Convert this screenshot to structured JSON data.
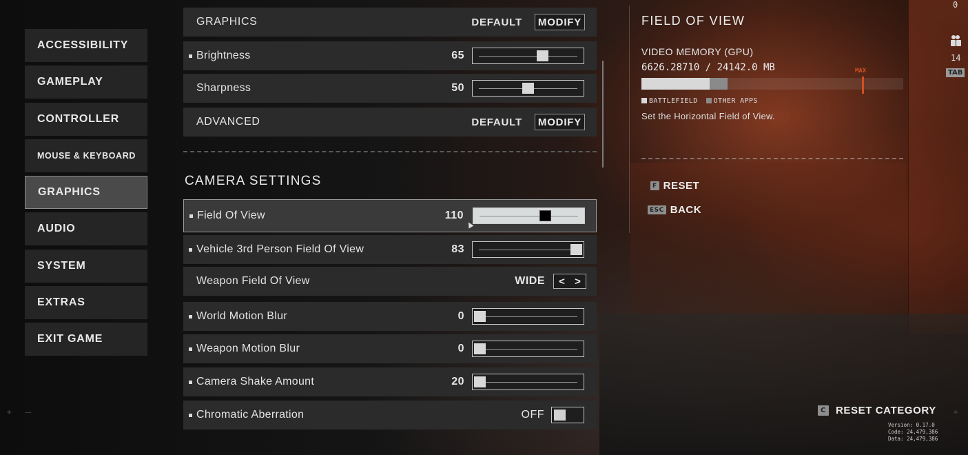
{
  "nav": {
    "items": [
      {
        "label": "ACCESSIBILITY",
        "active": false
      },
      {
        "label": "GAMEPLAY",
        "active": false
      },
      {
        "label": "CONTROLLER",
        "active": false
      },
      {
        "label": "MOUSE & KEYBOARD",
        "active": false
      },
      {
        "label": "GRAPHICS",
        "active": true
      },
      {
        "label": "AUDIO",
        "active": false
      },
      {
        "label": "SYSTEM",
        "active": false
      },
      {
        "label": "EXTRAS",
        "active": false
      },
      {
        "label": "EXIT GAME",
        "active": false
      }
    ]
  },
  "graphics_section": {
    "graphics_row": {
      "label": "GRAPHICS",
      "default_label": "DEFAULT",
      "modify_label": "MODIFY"
    },
    "brightness": {
      "label": "Brightness",
      "value": "65",
      "fraction": 0.65
    },
    "sharpness": {
      "label": "Sharpness",
      "value": "50",
      "fraction": 0.5
    },
    "advanced_row": {
      "label": "ADVANCED",
      "default_label": "DEFAULT",
      "modify_label": "MODIFY"
    }
  },
  "camera_section": {
    "title": "CAMERA SETTINGS",
    "fov": {
      "label": "Field Of View",
      "value": "110",
      "fraction": 0.67
    },
    "vehicle_fov": {
      "label": "Vehicle 3rd Person Field Of View",
      "value": "83",
      "fraction": 1.0
    },
    "weapon_fov": {
      "label": "Weapon Field Of View",
      "value": "WIDE",
      "prev": "<",
      "next": ">"
    },
    "world_blur": {
      "label": "World Motion Blur",
      "value": "0",
      "fraction": 0.0
    },
    "weapon_blur": {
      "label": "Weapon Motion Blur",
      "value": "0",
      "fraction": 0.0
    },
    "camera_shake": {
      "label": "Camera Shake Amount",
      "value": "20",
      "fraction": 0.0
    },
    "chromatic": {
      "label": "Chromatic Aberration",
      "value": "OFF",
      "on": false
    }
  },
  "info_panel": {
    "title": "FIELD OF VIEW",
    "vm_label": "VIDEO MEMORY (GPU)",
    "vm_value": "6626.28710 / 24142.0 MB",
    "battlefield_fraction": 0.26,
    "other_apps_fraction": 0.07,
    "max_fraction": 0.85,
    "max_label": "MAX",
    "legend_battlefield": "BATTLEFIELD",
    "legend_other": "OTHER APPS",
    "description": "Set the Horizontal Field of View.",
    "reset_key": "F",
    "reset_label": "RESET",
    "back_key": "ESC",
    "back_label": "BACK"
  },
  "hud": {
    "top_count": "0",
    "players": "14",
    "tab_key": "TAB"
  },
  "footer": {
    "reset_category_key": "C",
    "reset_category_label": "RESET CATEGORY",
    "version": "Version: 0.17.0",
    "code": "Code: 24,479,386",
    "data": "Data: 24,479,386"
  },
  "colors": {
    "accent_max": "#d05020",
    "bar_battlefield": "#d8d8d8",
    "bar_other": "#8a8a8a"
  }
}
